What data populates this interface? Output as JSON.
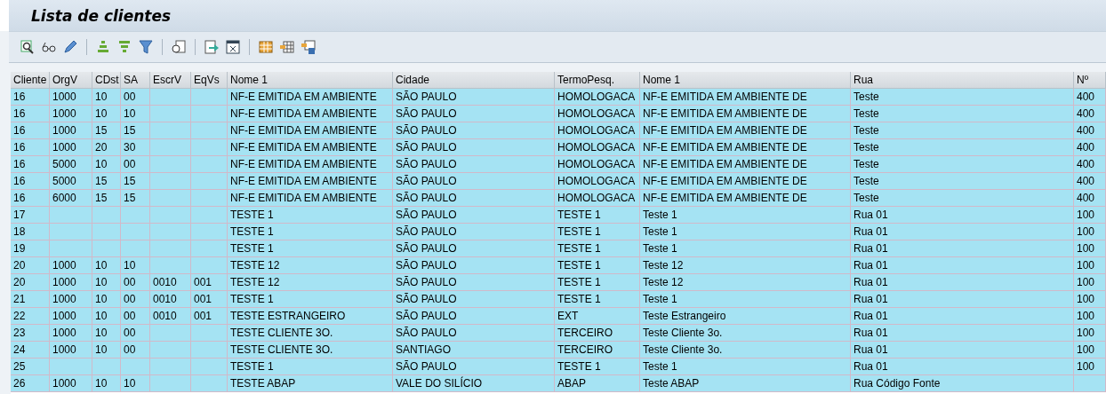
{
  "window": {
    "title": "Lista de clientes"
  },
  "table": {
    "columns": [
      "Cliente",
      "OrgV",
      "CDst",
      "SA",
      "EscrV",
      "EqVs",
      "Nome 1",
      "Cidade",
      "TermoPesq.",
      "Nome 1",
      "Rua",
      "Nº"
    ],
    "rows": [
      [
        "16",
        "1000",
        "10",
        "00",
        "",
        "",
        "NF-E EMITIDA EM AMBIENTE",
        "SÃO PAULO",
        "HOMOLOGACA",
        "NF-E EMITIDA EM AMBIENTE DE",
        "Teste",
        "400"
      ],
      [
        "16",
        "1000",
        "10",
        "10",
        "",
        "",
        "NF-E EMITIDA EM AMBIENTE",
        "SÃO PAULO",
        "HOMOLOGACA",
        "NF-E EMITIDA EM AMBIENTE DE",
        "Teste",
        "400"
      ],
      [
        "16",
        "1000",
        "15",
        "15",
        "",
        "",
        "NF-E EMITIDA EM AMBIENTE",
        "SÃO PAULO",
        "HOMOLOGACA",
        "NF-E EMITIDA EM AMBIENTE DE",
        "Teste",
        "400"
      ],
      [
        "16",
        "1000",
        "20",
        "30",
        "",
        "",
        "NF-E EMITIDA EM AMBIENTE",
        "SÃO PAULO",
        "HOMOLOGACA",
        "NF-E EMITIDA EM AMBIENTE DE",
        "Teste",
        "400"
      ],
      [
        "16",
        "5000",
        "10",
        "00",
        "",
        "",
        "NF-E EMITIDA EM AMBIENTE",
        "SÃO PAULO",
        "HOMOLOGACA",
        "NF-E EMITIDA EM AMBIENTE DE",
        "Teste",
        "400"
      ],
      [
        "16",
        "5000",
        "15",
        "15",
        "",
        "",
        "NF-E EMITIDA EM AMBIENTE",
        "SÃO PAULO",
        "HOMOLOGACA",
        "NF-E EMITIDA EM AMBIENTE DE",
        "Teste",
        "400"
      ],
      [
        "16",
        "6000",
        "15",
        "15",
        "",
        "",
        "NF-E EMITIDA EM AMBIENTE",
        "SÃO PAULO",
        "HOMOLOGACA",
        "NF-E EMITIDA EM AMBIENTE DE",
        "Teste",
        "400"
      ],
      [
        "17",
        "",
        "",
        "",
        "",
        "",
        "TESTE 1",
        "SÃO PAULO",
        "TESTE 1",
        "Teste 1",
        "Rua 01",
        "100"
      ],
      [
        "18",
        "",
        "",
        "",
        "",
        "",
        "TESTE 1",
        "SÃO PAULO",
        "TESTE 1",
        "Teste 1",
        "Rua 01",
        "100"
      ],
      [
        "19",
        "",
        "",
        "",
        "",
        "",
        "TESTE 1",
        "SÃO PAULO",
        "TESTE 1",
        "Teste 1",
        "Rua 01",
        "100"
      ],
      [
        "20",
        "1000",
        "10",
        "10",
        "",
        "",
        "TESTE 12",
        "SÃO PAULO",
        "TESTE 1",
        "Teste 12",
        "Rua 01",
        "100"
      ],
      [
        "20",
        "1000",
        "10",
        "00",
        "0010",
        "001",
        "TESTE 12",
        "SÃO PAULO",
        "TESTE 1",
        "Teste 12",
        "Rua 01",
        "100"
      ],
      [
        "21",
        "1000",
        "10",
        "00",
        "0010",
        "001",
        "TESTE 1",
        "SÃO PAULO",
        "TESTE 1",
        "Teste 1",
        "Rua 01",
        "100"
      ],
      [
        "22",
        "1000",
        "10",
        "00",
        "0010",
        "001",
        "TESTE ESTRANGEIRO",
        "SÃO PAULO",
        "EXT",
        "Teste Estrangeiro",
        "Rua 01",
        "100"
      ],
      [
        "23",
        "1000",
        "10",
        "00",
        "",
        "",
        "TESTE CLIENTE 3O.",
        "SÃO PAULO",
        "TERCEIRO",
        "Teste Cliente 3o.",
        "Rua 01",
        "100"
      ],
      [
        "24",
        "1000",
        "10",
        "00",
        "",
        "",
        "TESTE CLIENTE 3O.",
        "SANTIAGO",
        "TERCEIRO",
        "Teste Cliente 3o.",
        "Rua 01",
        "100"
      ],
      [
        "25",
        "",
        "",
        "",
        "",
        "",
        "TESTE 1",
        "SÃO PAULO",
        "TESTE 1",
        "Teste 1",
        "Rua 01",
        "100"
      ],
      [
        "26",
        "1000",
        "10",
        "10",
        "",
        "",
        "TESTE ABAP",
        "VALE DO SILÍCIO",
        "ABAP",
        "Teste ABAP",
        "Rua Código Fonte",
        ""
      ]
    ]
  }
}
